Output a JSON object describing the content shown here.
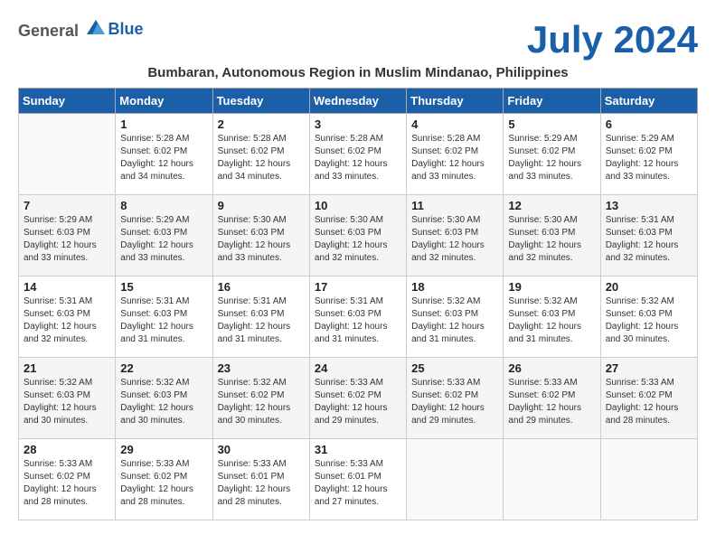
{
  "logo": {
    "general": "General",
    "blue": "Blue"
  },
  "title": "July 2024",
  "location": "Bumbaran, Autonomous Region in Muslim Mindanao, Philippines",
  "days_header": [
    "Sunday",
    "Monday",
    "Tuesday",
    "Wednesday",
    "Thursday",
    "Friday",
    "Saturday"
  ],
  "weeks": [
    [
      {
        "num": "",
        "info": ""
      },
      {
        "num": "1",
        "info": "Sunrise: 5:28 AM\nSunset: 6:02 PM\nDaylight: 12 hours\nand 34 minutes."
      },
      {
        "num": "2",
        "info": "Sunrise: 5:28 AM\nSunset: 6:02 PM\nDaylight: 12 hours\nand 34 minutes."
      },
      {
        "num": "3",
        "info": "Sunrise: 5:28 AM\nSunset: 6:02 PM\nDaylight: 12 hours\nand 33 minutes."
      },
      {
        "num": "4",
        "info": "Sunrise: 5:28 AM\nSunset: 6:02 PM\nDaylight: 12 hours\nand 33 minutes."
      },
      {
        "num": "5",
        "info": "Sunrise: 5:29 AM\nSunset: 6:02 PM\nDaylight: 12 hours\nand 33 minutes."
      },
      {
        "num": "6",
        "info": "Sunrise: 5:29 AM\nSunset: 6:02 PM\nDaylight: 12 hours\nand 33 minutes."
      }
    ],
    [
      {
        "num": "7",
        "info": "Sunrise: 5:29 AM\nSunset: 6:03 PM\nDaylight: 12 hours\nand 33 minutes."
      },
      {
        "num": "8",
        "info": "Sunrise: 5:29 AM\nSunset: 6:03 PM\nDaylight: 12 hours\nand 33 minutes."
      },
      {
        "num": "9",
        "info": "Sunrise: 5:30 AM\nSunset: 6:03 PM\nDaylight: 12 hours\nand 33 minutes."
      },
      {
        "num": "10",
        "info": "Sunrise: 5:30 AM\nSunset: 6:03 PM\nDaylight: 12 hours\nand 32 minutes."
      },
      {
        "num": "11",
        "info": "Sunrise: 5:30 AM\nSunset: 6:03 PM\nDaylight: 12 hours\nand 32 minutes."
      },
      {
        "num": "12",
        "info": "Sunrise: 5:30 AM\nSunset: 6:03 PM\nDaylight: 12 hours\nand 32 minutes."
      },
      {
        "num": "13",
        "info": "Sunrise: 5:31 AM\nSunset: 6:03 PM\nDaylight: 12 hours\nand 32 minutes."
      }
    ],
    [
      {
        "num": "14",
        "info": "Sunrise: 5:31 AM\nSunset: 6:03 PM\nDaylight: 12 hours\nand 32 minutes."
      },
      {
        "num": "15",
        "info": "Sunrise: 5:31 AM\nSunset: 6:03 PM\nDaylight: 12 hours\nand 31 minutes."
      },
      {
        "num": "16",
        "info": "Sunrise: 5:31 AM\nSunset: 6:03 PM\nDaylight: 12 hours\nand 31 minutes."
      },
      {
        "num": "17",
        "info": "Sunrise: 5:31 AM\nSunset: 6:03 PM\nDaylight: 12 hours\nand 31 minutes."
      },
      {
        "num": "18",
        "info": "Sunrise: 5:32 AM\nSunset: 6:03 PM\nDaylight: 12 hours\nand 31 minutes."
      },
      {
        "num": "19",
        "info": "Sunrise: 5:32 AM\nSunset: 6:03 PM\nDaylight: 12 hours\nand 31 minutes."
      },
      {
        "num": "20",
        "info": "Sunrise: 5:32 AM\nSunset: 6:03 PM\nDaylight: 12 hours\nand 30 minutes."
      }
    ],
    [
      {
        "num": "21",
        "info": "Sunrise: 5:32 AM\nSunset: 6:03 PM\nDaylight: 12 hours\nand 30 minutes."
      },
      {
        "num": "22",
        "info": "Sunrise: 5:32 AM\nSunset: 6:03 PM\nDaylight: 12 hours\nand 30 minutes."
      },
      {
        "num": "23",
        "info": "Sunrise: 5:32 AM\nSunset: 6:02 PM\nDaylight: 12 hours\nand 30 minutes."
      },
      {
        "num": "24",
        "info": "Sunrise: 5:33 AM\nSunset: 6:02 PM\nDaylight: 12 hours\nand 29 minutes."
      },
      {
        "num": "25",
        "info": "Sunrise: 5:33 AM\nSunset: 6:02 PM\nDaylight: 12 hours\nand 29 minutes."
      },
      {
        "num": "26",
        "info": "Sunrise: 5:33 AM\nSunset: 6:02 PM\nDaylight: 12 hours\nand 29 minutes."
      },
      {
        "num": "27",
        "info": "Sunrise: 5:33 AM\nSunset: 6:02 PM\nDaylight: 12 hours\nand 28 minutes."
      }
    ],
    [
      {
        "num": "28",
        "info": "Sunrise: 5:33 AM\nSunset: 6:02 PM\nDaylight: 12 hours\nand 28 minutes."
      },
      {
        "num": "29",
        "info": "Sunrise: 5:33 AM\nSunset: 6:02 PM\nDaylight: 12 hours\nand 28 minutes."
      },
      {
        "num": "30",
        "info": "Sunrise: 5:33 AM\nSunset: 6:01 PM\nDaylight: 12 hours\nand 28 minutes."
      },
      {
        "num": "31",
        "info": "Sunrise: 5:33 AM\nSunset: 6:01 PM\nDaylight: 12 hours\nand 27 minutes."
      },
      {
        "num": "",
        "info": ""
      },
      {
        "num": "",
        "info": ""
      },
      {
        "num": "",
        "info": ""
      }
    ]
  ]
}
